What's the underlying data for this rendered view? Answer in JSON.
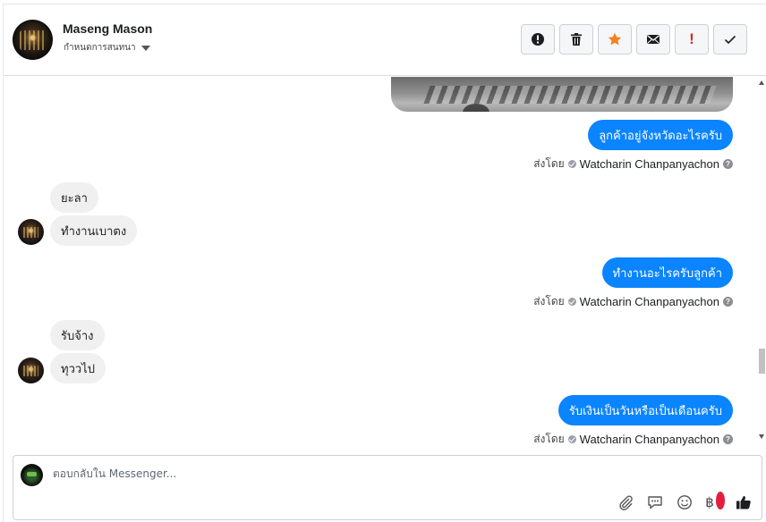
{
  "header": {
    "contact_name": "Maseng Mason",
    "assign_label": "กำหนดการสนทนา"
  },
  "actions": [
    {
      "name": "info-button",
      "icon": "alert-circle-icon"
    },
    {
      "name": "delete-button",
      "icon": "trash-icon"
    },
    {
      "name": "star-button",
      "icon": "star-icon",
      "color": "#f5821f"
    },
    {
      "name": "mark-unread-button",
      "icon": "envelope-icon"
    },
    {
      "name": "mark-spam-button",
      "icon": "exclamation-icon",
      "label": "!",
      "color": "#e02424"
    },
    {
      "name": "mark-done-button",
      "icon": "check-icon"
    }
  ],
  "messages": {
    "m1": {
      "text": "ลูกค้าอยู่จังหวัดอะไรครับ"
    },
    "s1": {
      "prefix": "ส่งโดย",
      "sender": "Watcharin Chanpanyachon"
    },
    "r1a": {
      "text": "ยะลา"
    },
    "r1b": {
      "text": "ทำงานเบาตง"
    },
    "m2": {
      "text": "ทำงานอะไรครับลูกค้า"
    },
    "s2": {
      "prefix": "ส่งโดย",
      "sender": "Watcharin Chanpanyachon"
    },
    "r2a": {
      "text": "รับจ้าง"
    },
    "r2b": {
      "text": "ทุววไป"
    },
    "m3": {
      "text": "รับเงินเป็นวันหรือเป็นเดือนครับ"
    },
    "s3": {
      "prefix": "ส่งโดย",
      "sender": "Watcharin Chanpanyachon"
    }
  },
  "composer": {
    "placeholder": "ตอบกลับใน Messenger...",
    "tools": [
      "paperclip-icon",
      "saved-reply-icon",
      "emoji-icon",
      "baht-payment-icon",
      "thumbs-up-icon"
    ],
    "baht_symbol": "฿"
  },
  "colors": {
    "outgoing_bubble": "#0a84ff",
    "incoming_bubble": "#f0f0f0"
  }
}
